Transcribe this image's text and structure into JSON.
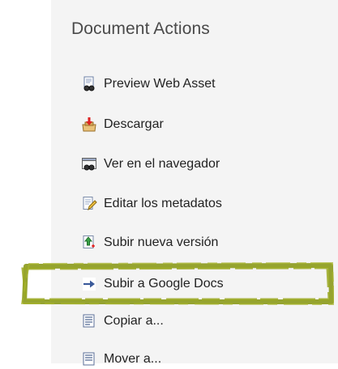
{
  "panel": {
    "title": "Document Actions"
  },
  "actions": [
    {
      "label": "Preview Web Asset",
      "icon": "preview-web-asset-icon"
    },
    {
      "label": "Descargar",
      "icon": "download-icon"
    },
    {
      "label": "Ver en el navegador",
      "icon": "view-in-browser-icon"
    },
    {
      "label": "Editar los metadatos",
      "icon": "edit-metadata-icon"
    },
    {
      "label": "Subir nueva versión",
      "icon": "upload-new-version-icon"
    },
    {
      "label": "Subir a Google Docs",
      "icon": "upload-to-google-docs-icon"
    },
    {
      "label": "Copiar a...",
      "icon": "copy-to-icon"
    },
    {
      "label": "Mover a...",
      "icon": "move-to-icon"
    }
  ],
  "colors": {
    "panel_bg": "#f4f4f4",
    "highlight": "#8b9a1b"
  }
}
